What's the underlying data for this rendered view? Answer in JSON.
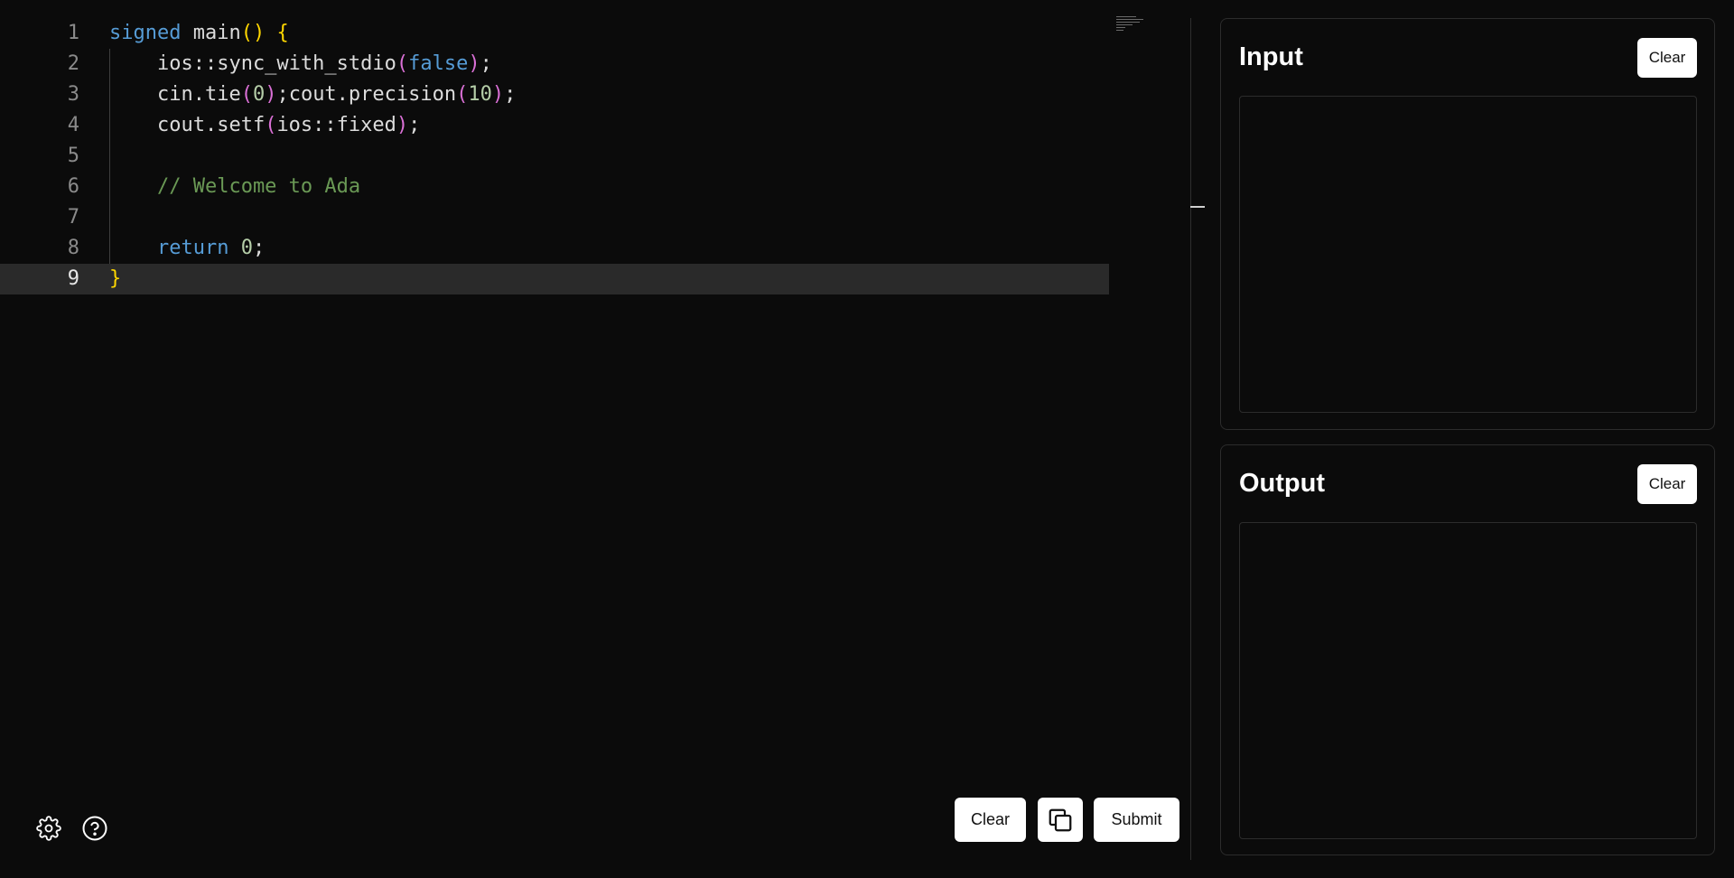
{
  "editor": {
    "lines": [
      {
        "number": "1",
        "tokens": [
          {
            "t": "signed",
            "c": "k"
          },
          {
            "t": " main",
            "c": ""
          },
          {
            "t": "()",
            "c": "b1"
          },
          {
            "t": " ",
            "c": ""
          },
          {
            "t": "{",
            "c": "b1"
          }
        ]
      },
      {
        "number": "2",
        "tokens": [
          {
            "t": "    ios::sync_with_stdio",
            "c": ""
          },
          {
            "t": "(",
            "c": "b2"
          },
          {
            "t": "false",
            "c": "k"
          },
          {
            "t": ")",
            "c": "b2"
          },
          {
            "t": ";",
            "c": ""
          }
        ]
      },
      {
        "number": "3",
        "tokens": [
          {
            "t": "    cin.tie",
            "c": ""
          },
          {
            "t": "(",
            "c": "b2"
          },
          {
            "t": "0",
            "c": "n"
          },
          {
            "t": ")",
            "c": "b2"
          },
          {
            "t": ";cout.precision",
            "c": ""
          },
          {
            "t": "(",
            "c": "b2"
          },
          {
            "t": "10",
            "c": "n"
          },
          {
            "t": ")",
            "c": "b2"
          },
          {
            "t": ";",
            "c": ""
          }
        ]
      },
      {
        "number": "4",
        "tokens": [
          {
            "t": "    cout.setf",
            "c": ""
          },
          {
            "t": "(",
            "c": "b2"
          },
          {
            "t": "ios::fixed",
            "c": ""
          },
          {
            "t": ")",
            "c": "b2"
          },
          {
            "t": ";",
            "c": ""
          }
        ]
      },
      {
        "number": "5",
        "tokens": []
      },
      {
        "number": "6",
        "tokens": [
          {
            "t": "    // Welcome to Ada",
            "c": "c"
          }
        ]
      },
      {
        "number": "7",
        "tokens": []
      },
      {
        "number": "8",
        "tokens": [
          {
            "t": "    ",
            "c": ""
          },
          {
            "t": "return",
            "c": "k"
          },
          {
            "t": " ",
            "c": ""
          },
          {
            "t": "0",
            "c": "n"
          },
          {
            "t": ";",
            "c": ""
          }
        ]
      },
      {
        "number": "9",
        "tokens": [
          {
            "t": "}",
            "c": "b1"
          }
        ]
      }
    ],
    "current_line": 9
  },
  "toolbar": {
    "clear_label": "Clear",
    "copy_icon": "copy-icon",
    "submit_label": "Submit",
    "settings_icon": "gear-icon",
    "help_icon": "help-icon"
  },
  "input_panel": {
    "title": "Input",
    "clear_label": "Clear",
    "value": ""
  },
  "output_panel": {
    "title": "Output",
    "clear_label": "Clear",
    "value": ""
  },
  "colors": {
    "background": "#0b0b0b",
    "keyword": "#569cd6",
    "bracket_level1": "#ffd700",
    "bracket_level2": "#da70d6",
    "number": "#b5cea8",
    "comment": "#6a9955",
    "current_line": "#2a2a2a"
  }
}
